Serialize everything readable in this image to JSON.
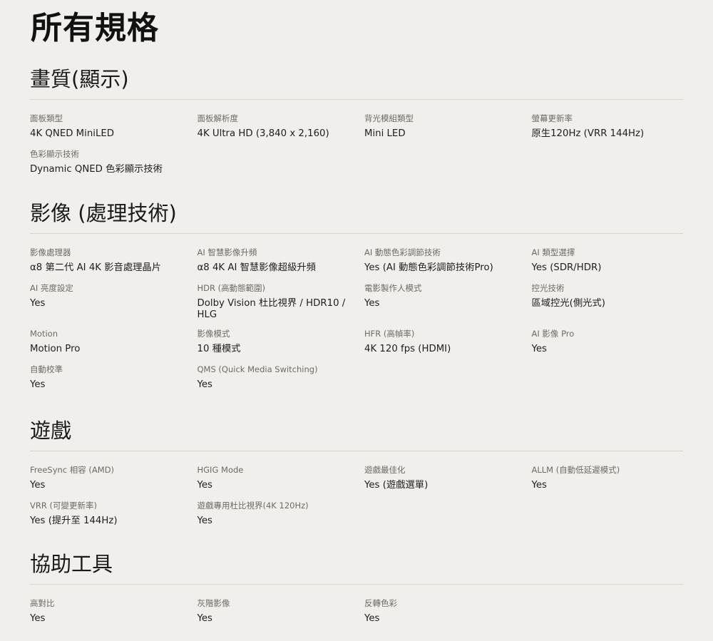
{
  "page_title": "所有規格",
  "sections": [
    {
      "title": "畫質(顯示)",
      "specs": [
        {
          "label": "面板類型",
          "value": "4K QNED MiniLED"
        },
        {
          "label": "面板解析度",
          "value": "4K Ultra HD (3,840 x 2,160)"
        },
        {
          "label": "背光模組類型",
          "value": "Mini LED"
        },
        {
          "label": "螢幕更新率",
          "value": "原生120Hz (VRR 144Hz)"
        },
        {
          "label": "色彩顯示技術",
          "value": "Dynamic QNED 色彩顯示技術"
        }
      ]
    },
    {
      "title": "影像 (處理技術)",
      "specs": [
        {
          "label": "影像處理器",
          "value": "α8 第二代 AI 4K 影音處理晶片"
        },
        {
          "label": "AI 智慧影像升頻",
          "value": "α8 4K AI 智慧影像超級升頻"
        },
        {
          "label": "AI 動態色彩調節技術",
          "value": "Yes (AI 動態色彩調節技術Pro)"
        },
        {
          "label": "AI 類型選擇",
          "value": "Yes (SDR/HDR)"
        },
        {
          "label": "AI 亮度設定",
          "value": "Yes"
        },
        {
          "label": "HDR (高動態範圍)",
          "value": "Dolby Vision 杜比視界 / HDR10 / HLG"
        },
        {
          "label": "電影製作人模式",
          "value": "Yes"
        },
        {
          "label": "控光技術",
          "value": "區域控光(側光式)"
        },
        {
          "label": "Motion",
          "value": "Motion Pro"
        },
        {
          "label": "影像模式",
          "value": "10 種模式"
        },
        {
          "label": "HFR (高幀率)",
          "value": "4K 120 fps (HDMI)"
        },
        {
          "label": "AI 影像 Pro",
          "value": "Yes"
        },
        {
          "label": "自動校準",
          "value": "Yes"
        },
        {
          "label": "QMS (Quick Media Switching)",
          "value": "Yes"
        }
      ]
    },
    {
      "title": "遊戲",
      "specs": [
        {
          "label": "FreeSync 相容 (AMD)",
          "value": "Yes"
        },
        {
          "label": "HGIG Mode",
          "value": "Yes"
        },
        {
          "label": "遊戲最佳化",
          "value": "Yes (遊戲選單)"
        },
        {
          "label": "ALLM (自動低延遲模式)",
          "value": "Yes"
        },
        {
          "label": "VRR (可變更新率)",
          "value": "Yes (提升至 144Hz)"
        },
        {
          "label": "遊戲專用杜比視界(4K 120Hz)",
          "value": "Yes"
        }
      ]
    },
    {
      "title": "協助工具",
      "specs": [
        {
          "label": "高對比",
          "value": "Yes"
        },
        {
          "label": "灰階影像",
          "value": "Yes"
        },
        {
          "label": "反轉色彩",
          "value": "Yes"
        }
      ]
    }
  ]
}
